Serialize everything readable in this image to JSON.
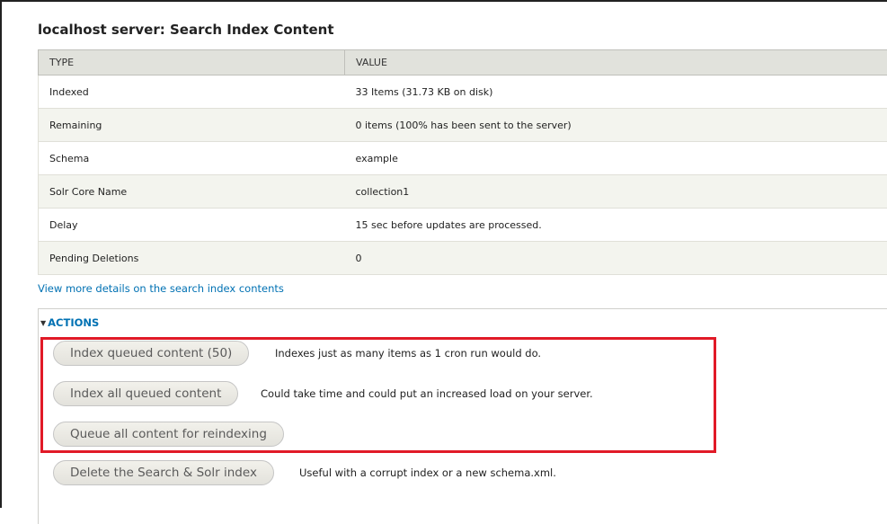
{
  "page": {
    "title": "localhost server: Search Index Content"
  },
  "table": {
    "headers": [
      "TYPE",
      "VALUE"
    ],
    "rows": [
      {
        "type": "Indexed",
        "value": "33 Items (31.73 KB on disk)"
      },
      {
        "type": "Remaining",
        "value": "0 items (100% has been sent to the server)"
      },
      {
        "type": "Schema",
        "value": "example"
      },
      {
        "type": "Solr Core Name",
        "value": "collection1"
      },
      {
        "type": "Delay",
        "value": "15 sec before updates are processed."
      },
      {
        "type": "Pending Deletions",
        "value": "0"
      }
    ]
  },
  "details_link": "View more details on the search index contents",
  "actions": {
    "legend": "ACTIONS",
    "items": [
      {
        "label": "Index queued content (50)",
        "description": "Indexes just as many items as 1 cron run would do."
      },
      {
        "label": "Index all queued content",
        "description": "Could take time and could put an increased load on your server."
      },
      {
        "label": "Queue all content for reindexing",
        "description": ""
      },
      {
        "label": "Delete the Search & Solr index",
        "description": "Useful with a corrupt index or a new schema.xml."
      }
    ]
  },
  "colors": {
    "link": "#0071b3",
    "highlight": "#e11a27",
    "header_bg": "#e1e2dc",
    "even_row_bg": "#f3f4ee"
  }
}
